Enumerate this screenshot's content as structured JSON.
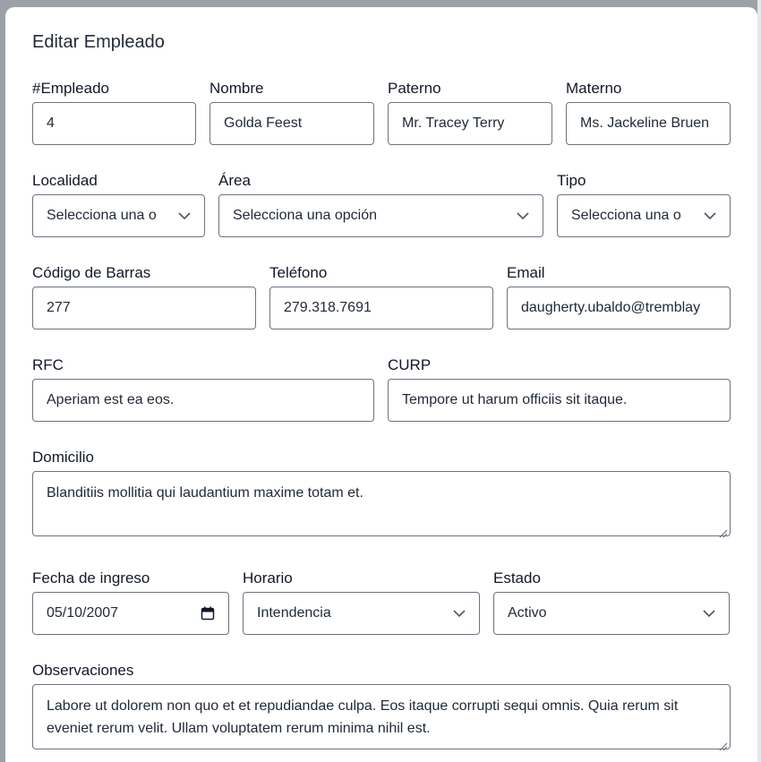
{
  "modal": {
    "title": "Editar Empleado"
  },
  "form": {
    "empleado": {
      "label": "#Empleado",
      "value": "4"
    },
    "nombre": {
      "label": "Nombre",
      "value": "Golda Feest"
    },
    "paterno": {
      "label": "Paterno",
      "value": "Mr. Tracey Terry"
    },
    "materno": {
      "label": "Materno",
      "value": "Ms. Jackeline Bruen"
    },
    "localidad": {
      "label": "Localidad",
      "value": "Selecciona una o"
    },
    "area": {
      "label": "Área",
      "value": "Selecciona una opción"
    },
    "tipo": {
      "label": "Tipo",
      "value": "Selecciona una o"
    },
    "codigo_barras": {
      "label": "Código de Barras",
      "value": "277"
    },
    "telefono": {
      "label": "Teléfono",
      "value": "279.318.7691"
    },
    "email": {
      "label": "Email",
      "value": "daugherty.ubaldo@tremblay"
    },
    "rfc": {
      "label": "RFC",
      "value": "Aperiam est ea eos."
    },
    "curp": {
      "label": "CURP",
      "value": "Tempore ut harum officiis sit itaque."
    },
    "domicilio": {
      "label": "Domicilio",
      "value": "Blanditiis mollitia qui laudantium maxime totam et."
    },
    "fecha_ingreso": {
      "label": "Fecha de ingreso",
      "value": "05/10/2007"
    },
    "horario": {
      "label": "Horario",
      "value": "Intendencia"
    },
    "estado": {
      "label": "Estado",
      "value": "Activo"
    },
    "observaciones": {
      "label": "Observaciones",
      "value": "Labore ut dolorem non quo et et repudiandae culpa. Eos itaque corrupti sequi omnis. Quia rerum sit eveniet rerum velit. Ullam voluptatem rerum minima nihil est."
    }
  },
  "icons": {
    "select_chevron": "chevron-down-icon",
    "date_picker": "calendar-icon",
    "textarea_resize": "resize-handle-icon"
  },
  "colors": {
    "overlay": "#9ca0a8",
    "modal_bg": "#ffffff",
    "input_border": "#6b7280",
    "text": "#111827"
  }
}
